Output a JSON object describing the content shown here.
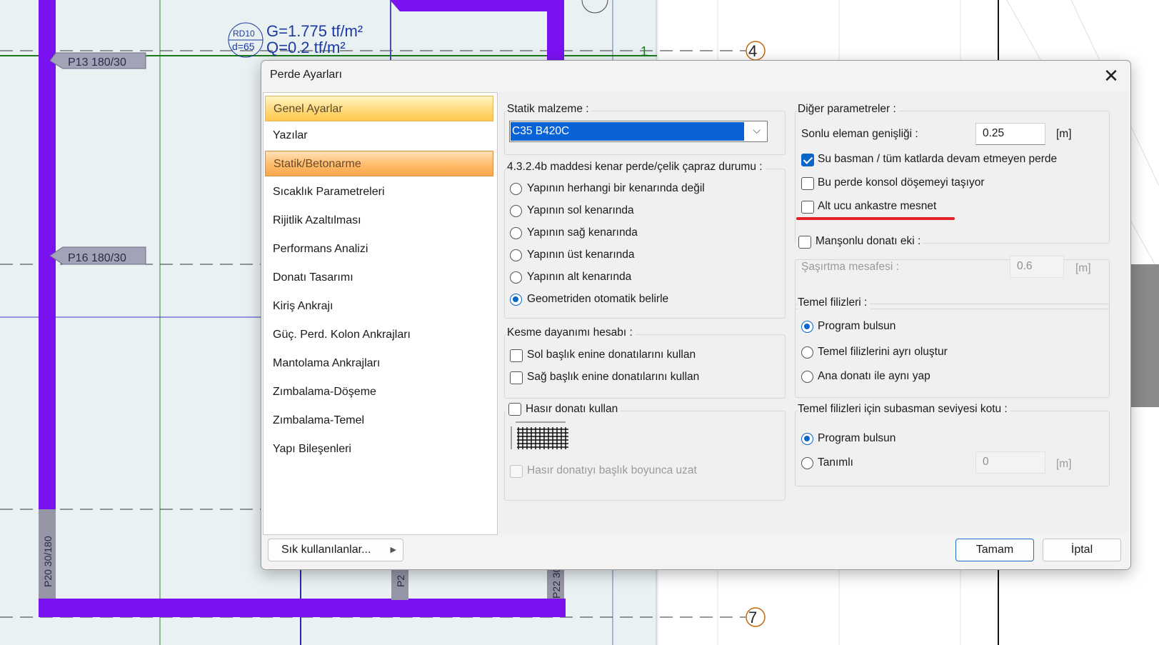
{
  "background": {
    "annotations": {
      "rd": "RD10",
      "d": "d=65",
      "g_load": "G=1.775 tf/m²",
      "q_load": "Q=0.2 tf/m²",
      "axis_4": "4",
      "axis_7": "7",
      "axis_1": "1"
    },
    "tags": {
      "p13": "P13 180/30",
      "p16": "P16 180/30",
      "p20": "P20 30/180",
      "p2x": "P2",
      "p22": "P22 30"
    }
  },
  "dialog": {
    "title": "Perde Ayarları",
    "nav_items": [
      {
        "label": "Genel Ayarlar",
        "state": "selected-yellow"
      },
      {
        "label": "Yazılar"
      },
      {
        "label": "Statik/Betonarme",
        "state": "selected-orange"
      },
      {
        "label": "Sıcaklık Parametreleri"
      },
      {
        "label": "Rijitlik Azaltılması"
      },
      {
        "label": "Performans Analizi"
      },
      {
        "label": "Donatı Tasarımı"
      },
      {
        "label": "Kiriş Ankrajı"
      },
      {
        "label": "Güç. Perd. Kolon Ankrajları"
      },
      {
        "label": "Mantolama Ankrajları"
      },
      {
        "label": "Zımbalama-Döşeme"
      },
      {
        "label": "Zımbalama-Temel"
      },
      {
        "label": "Yapı Bileşenleri"
      }
    ],
    "favorites_button": "Sık kullanılanlar...",
    "ok_button": "Tamam",
    "cancel_button": "İptal",
    "statik_malzeme": {
      "label": "Statik malzeme :",
      "value": "C35 B420C"
    },
    "kenar_perde": {
      "label": "4.3.2.4b maddesi kenar perde/çelik çapraz durumu :",
      "options": [
        {
          "label": "Yapının herhangi bir kenarında değil",
          "checked": false
        },
        {
          "label": "Yapının sol kenarında",
          "checked": false
        },
        {
          "label": "Yapının sağ kenarında",
          "checked": false
        },
        {
          "label": "Yapının üst kenarında",
          "checked": false
        },
        {
          "label": "Yapının alt kenarında",
          "checked": false
        },
        {
          "label": "Geometriden otomatik belirle",
          "checked": true
        }
      ]
    },
    "kesme": {
      "label": "Kesme dayanımı hesabı :",
      "options": [
        {
          "label": "Sol başlık enine donatılarını kullan",
          "checked": false
        },
        {
          "label": "Sağ başlık enine donatılarını kullan",
          "checked": false
        }
      ]
    },
    "hasir": {
      "label": "Hasır donatı kullan",
      "checked": false,
      "sub_label": "Hasır donatıyı başlık boyunca uzat"
    },
    "diger": {
      "label": "Diğer parametreler :",
      "sonlu_label": "Sonlu eleman genişliği :",
      "sonlu_value": "0.25",
      "unit_m": "[m]",
      "checks": [
        {
          "label": "Su basman / tüm katlarda devam etmeyen perde",
          "checked": true
        },
        {
          "label": "Bu perde konsol döşemeyi taşıyor",
          "checked": false
        },
        {
          "label": "Alt ucu ankastre mesnet",
          "checked": false
        }
      ],
      "underline_color": "#e3212b"
    },
    "manson": {
      "label": "Manşonlu donatı eki :",
      "checked": false,
      "sasirtma_label": "Şaşırtma mesafesi :",
      "sasirtma_value": "0.6",
      "unit_m": "[m]"
    },
    "temel_filiz": {
      "label": "Temel filizleri :",
      "options": [
        {
          "label": "Program bulsun",
          "checked": true
        },
        {
          "label": "Temel filizlerini ayrı oluştur",
          "checked": false
        },
        {
          "label": "Ana donatı ile aynı yap",
          "checked": false
        }
      ]
    },
    "subasman": {
      "label": "Temel filizleri için subasman seviyesi kotu  :",
      "options": [
        {
          "label": "Program bulsun",
          "checked": true
        },
        {
          "label": "Tanımlı",
          "checked": false
        }
      ],
      "value": "0",
      "unit_m": "[m]"
    }
  }
}
